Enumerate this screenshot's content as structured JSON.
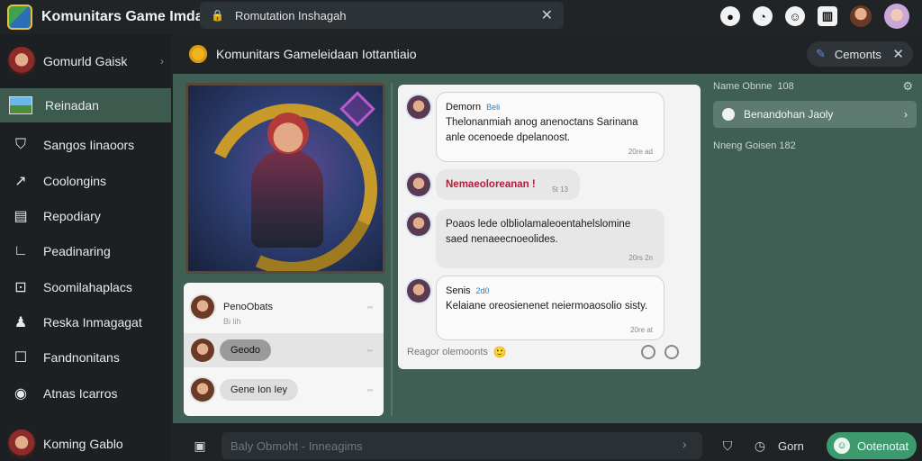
{
  "app": {
    "title": "Komunitars Game Imda",
    "search_text": "Romutation Inshagah"
  },
  "sidebar": {
    "user_label": "Gomurld Gaisk",
    "items": [
      {
        "label": "Reinadan",
        "icon": "picture-icon",
        "active": true
      },
      {
        "label": "Sangos Iinaoors",
        "icon": "shield-icon"
      },
      {
        "label": "Coolongins",
        "icon": "arrow-icon"
      },
      {
        "label": "Repodiary",
        "icon": "document-icon"
      },
      {
        "label": "Peadinaring",
        "icon": "corner-icon"
      },
      {
        "label": "Soomilahaplacs",
        "icon": "image-frame-icon"
      },
      {
        "label": "Reska Inmagagat",
        "icon": "person-icon"
      },
      {
        "label": "Fandnonitans",
        "icon": "square-icon"
      },
      {
        "label": "Atnas Icarros",
        "icon": "radio-icon"
      }
    ],
    "bottom_user": "Koming Gablo"
  },
  "channel": {
    "title": "Komunitars Gameleidaan Iottantiaio",
    "button_label": "Cemonts"
  },
  "threads": [
    {
      "name": "PenoObats",
      "sub": "Bi lih",
      "mark": "◦◦",
      "selected": false
    },
    {
      "name": "Geodo",
      "mark": "◦◦",
      "selected": true
    },
    {
      "name": "Gene Ion Iey",
      "mark": "◦◦",
      "selected": false
    }
  ],
  "chat": {
    "messages": [
      {
        "author": "Demorn",
        "tag": "Beli",
        "text": "Thelonanmiah anog anenoctans Sarinana anle ocenoede dpelanoost.",
        "time": "20re ad"
      },
      {
        "text": "Nemaeoloreanan !",
        "time": "5t 13",
        "alert": true
      },
      {
        "text": "Poaos lede olbliolamaleoentahelslomine saed nenaeecnoeolides.",
        "time": "20rs 2n"
      },
      {
        "author": "Senis",
        "tag": "2d0",
        "text": "Kelaiane oreosienenet neiermoaosolio sisty.",
        "time": "20re at"
      }
    ],
    "footer_hint": "Reagor olemoonts",
    "footer_emoji": "🙂"
  },
  "rightcol": {
    "title": "Name Obnne",
    "title_count": "108",
    "card_label": "Benandohan Jaoly",
    "subtitle": "Nneng Goisen",
    "subtitle_count": "182"
  },
  "composer": {
    "placeholder": "Baly Obmoht - Inneagims",
    "extra_label": "Gorn",
    "button_label": "Ootenotat"
  },
  "colors": {
    "accent_green": "#3d9a6e",
    "panel_green": "#3f5e54",
    "active_item": "#3d5a4e",
    "alert_red": "#b0203a"
  }
}
